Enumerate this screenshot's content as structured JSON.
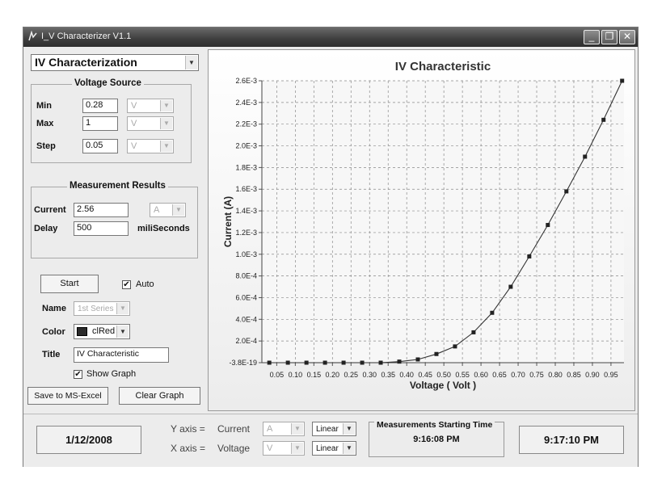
{
  "window": {
    "title": "I_V Characterizer V1.1",
    "controls": {
      "minimize": "_",
      "maximize": "❐",
      "close": "✕"
    }
  },
  "left_panel": {
    "mode_select": {
      "value": "IV Characterization"
    },
    "voltage_source": {
      "title": "Voltage Source",
      "rows": [
        {
          "label": "Min",
          "value": "0.28",
          "unit": "V"
        },
        {
          "label": "Max",
          "value": "1",
          "unit": "V"
        },
        {
          "label": "Step",
          "value": "0.05",
          "unit": "V"
        }
      ]
    },
    "measurement_results": {
      "title": "Measurement Results",
      "current_label": "Current",
      "current_value": "2.56",
      "current_unit": "A",
      "delay_label": "Delay",
      "delay_value": "500",
      "delay_unit": "miliSeconds"
    },
    "start_button": "Start",
    "auto_label": "Auto",
    "auto_checked": true,
    "name_label": "Name",
    "name_value": "1st Series",
    "color_label": "Color",
    "color_value": "clRed",
    "color_swatch": "#2b2b2b",
    "title_label": "Title",
    "title_value": "IV Characteristic",
    "show_graph_label": "Show Graph",
    "show_graph_checked": true,
    "save_button": "Save to MS-Excel",
    "clear_button": "Clear Graph"
  },
  "chart_data": {
    "type": "line",
    "title": "IV Characteristic",
    "xlabel": "Voltage ( Volt )",
    "ylabel": "Current (A)",
    "xlim": [
      0.01,
      0.985
    ],
    "ylim": [
      -3.8e-19,
      0.0026
    ],
    "x_ticks": [
      "0.05",
      "0.10",
      "0.15",
      "0.20",
      "0.25",
      "0.30",
      "0.35",
      "0.40",
      "0.45",
      "0.50",
      "0.55",
      "0.60",
      "0.65",
      "0.70",
      "0.75",
      "0.80",
      "0.85",
      "0.90",
      "0.95"
    ],
    "y_ticks": [
      {
        "value": -3.8e-19,
        "label": "-3.8E-19"
      },
      {
        "value": 0.0002,
        "label": "2.0E-4"
      },
      {
        "value": 0.0004,
        "label": "4.0E-4"
      },
      {
        "value": 0.0006,
        "label": "6.0E-4"
      },
      {
        "value": 0.0008,
        "label": "8.0E-4"
      },
      {
        "value": 0.001,
        "label": "1.0E-3"
      },
      {
        "value": 0.0012,
        "label": "1.2E-3"
      },
      {
        "value": 0.0014,
        "label": "1.4E-3"
      },
      {
        "value": 0.0016,
        "label": "1.6E-3"
      },
      {
        "value": 0.0018,
        "label": "1.8E-3"
      },
      {
        "value": 0.002,
        "label": "2.0E-3"
      },
      {
        "value": 0.0022,
        "label": "2.2E-3"
      },
      {
        "value": 0.0024,
        "label": "2.4E-3"
      },
      {
        "value": 0.0026,
        "label": "2.6E-3"
      }
    ],
    "grid": true,
    "series": [
      {
        "color": "#333333",
        "x": [
          0.03,
          0.08,
          0.13,
          0.18,
          0.23,
          0.28,
          0.33,
          0.38,
          0.43,
          0.48,
          0.53,
          0.58,
          0.63,
          0.68,
          0.73,
          0.78,
          0.83,
          0.88,
          0.93,
          0.98
        ],
        "y": [
          0,
          0,
          0,
          0,
          0,
          0,
          0,
          1e-05,
          3e-05,
          8e-05,
          0.00015,
          0.00028,
          0.00046,
          0.0007,
          0.00098,
          0.00127,
          0.00158,
          0.0019,
          0.00224,
          0.0026
        ]
      }
    ]
  },
  "bottom_bar": {
    "date": "1/12/2008",
    "y_axis_label": "Y axis =",
    "y_axis_quantity": "Current",
    "y_axis_unit": "A",
    "y_axis_scale": "Linear",
    "x_axis_label": "X axis =",
    "x_axis_quantity": "Voltage",
    "x_axis_unit": "V",
    "x_axis_scale": "Linear",
    "start_time_title": "Measurements Starting Time",
    "start_time": "9:16:08 PM",
    "current_time": "9:17:10 PM"
  }
}
